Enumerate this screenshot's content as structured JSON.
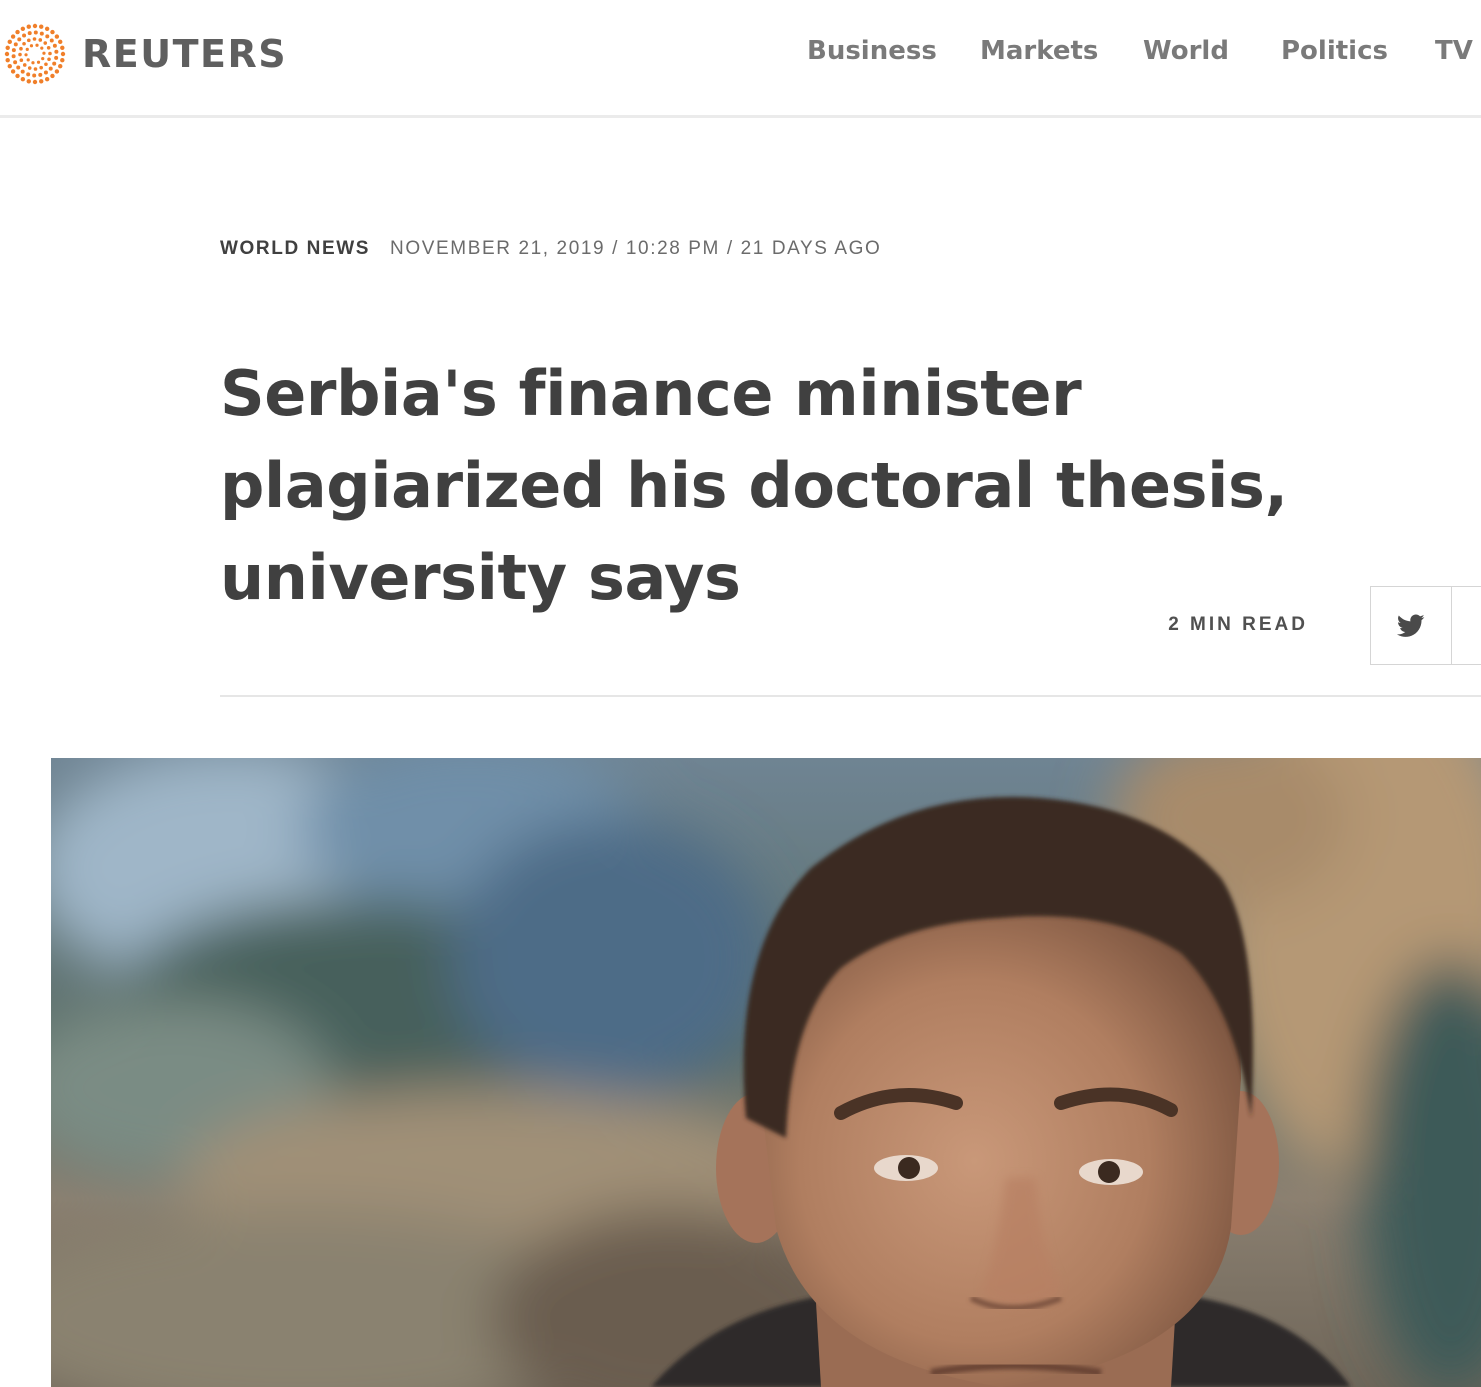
{
  "header": {
    "logo_icon": "reuters-dot-circle-icon",
    "brand_name": "REUTERS",
    "brand_color": "#f07f2a",
    "nav": [
      {
        "label": "Business"
      },
      {
        "label": "Markets"
      },
      {
        "label": "World"
      },
      {
        "label": "Politics"
      },
      {
        "label": "TV"
      }
    ]
  },
  "article": {
    "section": "WORLD NEWS",
    "dateline": "NOVEMBER 21, 2019 / 10:28 PM / 21 DAYS AGO",
    "headline": "Serbia's finance minister plagiarized his doctoral thesis, university says",
    "read_time": "2 MIN READ",
    "share": [
      {
        "icon": "twitter-icon"
      },
      {
        "icon": "facebook-icon"
      }
    ],
    "lead_image": {
      "alt": "photo-of-man"
    }
  }
}
